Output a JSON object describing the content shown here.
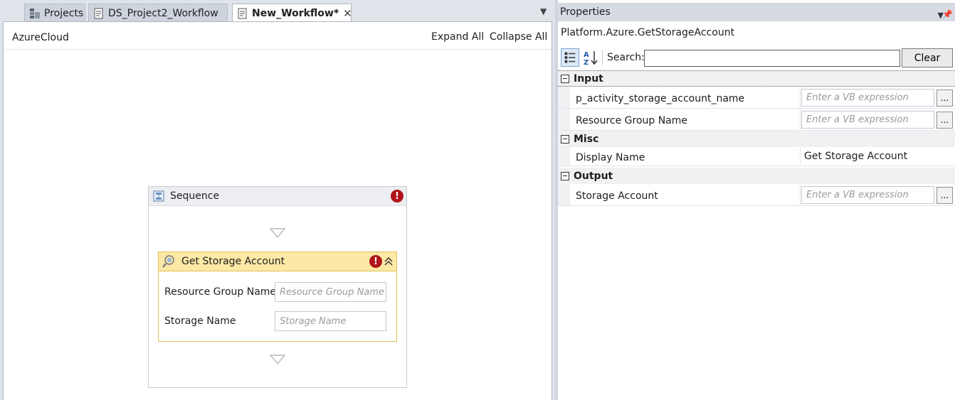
{
  "tabs": [
    {
      "label": "Projects",
      "active": false
    },
    {
      "label": "DS_Project2_Workflow",
      "active": false
    },
    {
      "label": "New_Workflow*",
      "active": true
    }
  ],
  "designer": {
    "breadcrumb": "AzureCloud",
    "expand_all": "Expand All",
    "collapse_all": "Collapse All",
    "sequence": {
      "title": "Sequence",
      "activity": {
        "title": "Get Storage Account",
        "fields": [
          {
            "label": "Resource Group Name",
            "placeholder": "Resource Group Name"
          },
          {
            "label": "Storage Name",
            "placeholder": "Storage Name"
          }
        ]
      }
    }
  },
  "properties": {
    "title": "Properties",
    "type_name": "Platform.Azure.GetStorageAccount",
    "search_label": "Search:",
    "clear_label": "Clear",
    "vb_placeholder": "Enter a VB expression",
    "ellipsis": "...",
    "categories": [
      {
        "name": "Input",
        "rows": [
          {
            "name": "p_activity_storage_account_name"
          },
          {
            "name": "Resource Group Name"
          }
        ]
      },
      {
        "name": "Misc",
        "rows": [
          {
            "name": "Display Name",
            "value": "Get Storage Account"
          }
        ]
      },
      {
        "name": "Output",
        "rows": [
          {
            "name": "Storage Account"
          }
        ]
      }
    ]
  },
  "colors": {
    "activity_header": "#fde9a6",
    "activity_border": "#e4be56",
    "error": "#b0141a",
    "panel_bg": "#dfe3ea"
  }
}
